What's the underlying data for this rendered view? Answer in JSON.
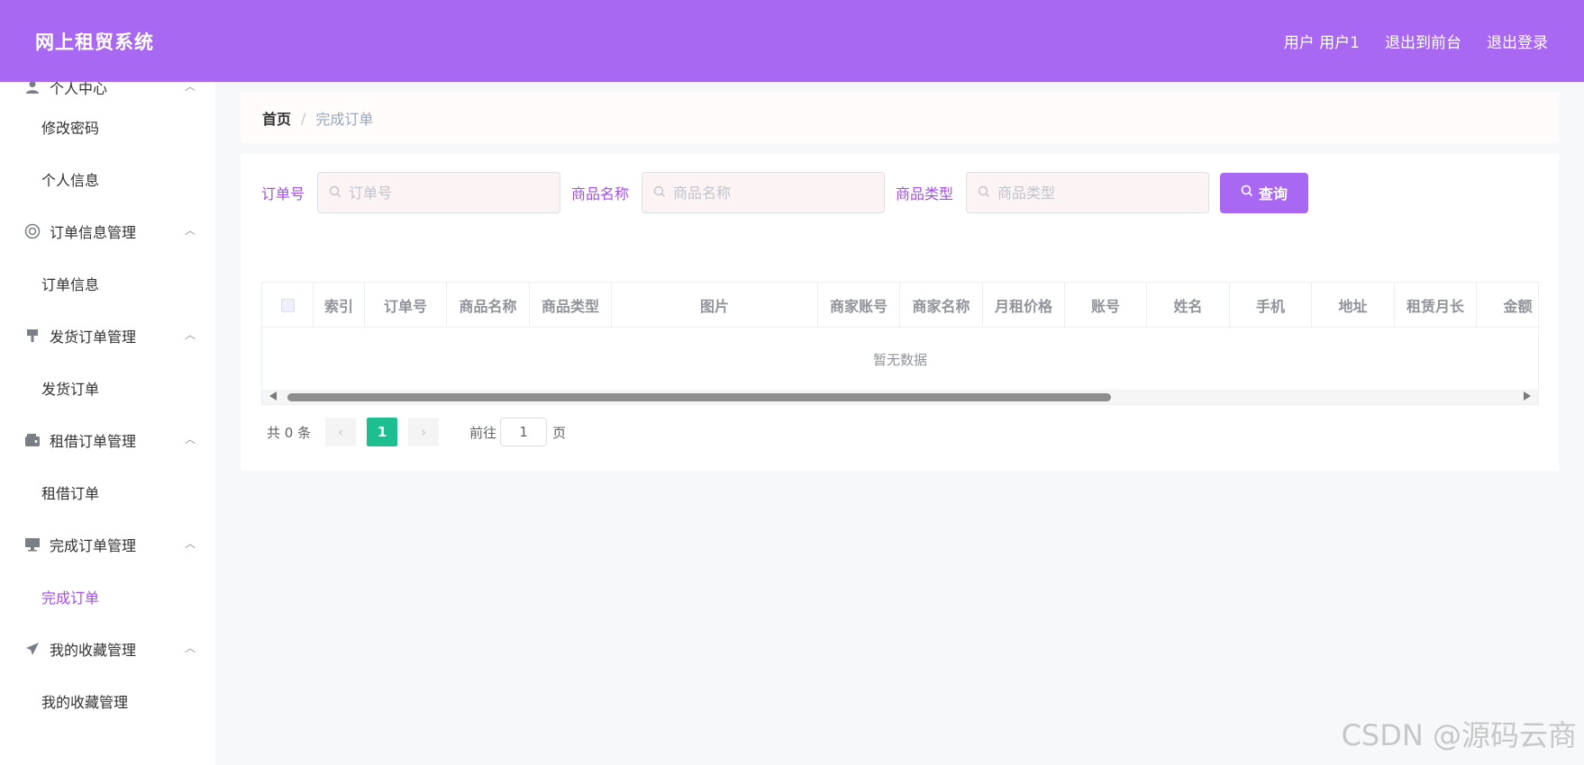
{
  "header": {
    "title": "网上租贸系统",
    "user_label": "用户 用户1",
    "exit_front": "退出到前台",
    "logout": "退出登录"
  },
  "sidebar": {
    "groups": [
      {
        "title": "个人中心",
        "icon": "user-icon",
        "items": [
          "修改密码",
          "个人信息"
        ]
      },
      {
        "title": "订单信息管理",
        "icon": "lifebuoy-icon",
        "items": [
          "订单信息"
        ]
      },
      {
        "title": "发货订单管理",
        "icon": "brush-icon",
        "items": [
          "发货订单"
        ]
      },
      {
        "title": "租借订单管理",
        "icon": "wallet-icon",
        "items": [
          "租借订单"
        ]
      },
      {
        "title": "完成订单管理",
        "icon": "monitor-icon",
        "items": [
          "完成订单"
        ]
      },
      {
        "title": "我的收藏管理",
        "icon": "send-icon",
        "items": [
          "我的收藏管理"
        ]
      }
    ],
    "active_item": "完成订单"
  },
  "breadcrumb": {
    "home": "首页",
    "separator": "/",
    "current": "完成订单"
  },
  "search": {
    "order_no_label": "订单号",
    "order_no_placeholder": "订单号",
    "product_name_label": "商品名称",
    "product_name_placeholder": "商品名称",
    "product_type_label": "商品类型",
    "product_type_placeholder": "商品类型",
    "query_button": "查询"
  },
  "table": {
    "columns": [
      "索引",
      "订单号",
      "商品名称",
      "商品类型",
      "图片",
      "商家账号",
      "商家名称",
      "月租价格",
      "账号",
      "姓名",
      "手机",
      "地址",
      "租赁月长",
      "金额"
    ],
    "empty_text": "暂无数据"
  },
  "pagination": {
    "total_text": "共 0 条",
    "current_page": "1",
    "goto_label": "前往",
    "goto_value": "1",
    "page_suffix": "页"
  },
  "watermark": "CSDN @源码云商",
  "colors": {
    "primary": "#a968f2",
    "active_text": "#a34fe3",
    "pager_active": "#1dbf8f"
  }
}
